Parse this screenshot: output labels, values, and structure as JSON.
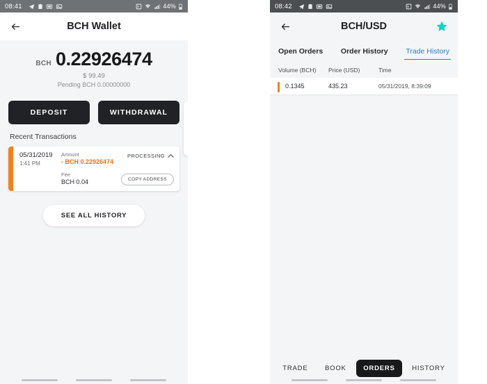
{
  "left_phone": {
    "status_bar": {
      "time": "08:41",
      "battery": "44%",
      "icons": [
        "telegram-icon",
        "clipboard-icon",
        "screenshot-icon",
        "gallery-icon",
        "vpn-icon",
        "wifi-icon",
        "signal-icon",
        "battery-icon"
      ]
    },
    "app_bar": {
      "back_label": "←",
      "title": "BCH Wallet"
    },
    "balance": {
      "unit": "BCH",
      "amount": "0.22926474",
      "fiat": "$ 99.49",
      "pending": "Pending BCH 0.00000000"
    },
    "actions": {
      "deposit": "DEPOSIT",
      "withdrawal": "WITHDRAWAL"
    },
    "recent_transactions_label": "Recent Transactions",
    "transaction": {
      "date": "05/31/2019",
      "time": "1:41 PM",
      "amount_label": "Amount",
      "amount_value": "- BCH 0.22926474",
      "fee_label": "Fee",
      "fee_value": "BCH 0.04",
      "status": "PROCESSING",
      "copy_button": "COPY ADDRESS",
      "accent_color": "#f2811d"
    },
    "see_all_history": "SEE ALL HISTORY"
  },
  "right_phone": {
    "status_bar": {
      "time": "08:42",
      "battery": "44%"
    },
    "app_bar": {
      "back_label": "←",
      "title": "BCH/USD",
      "star_color": "#10d5c3"
    },
    "tabs": [
      {
        "label": "Open Orders",
        "active": false
      },
      {
        "label": "Order History",
        "active": false
      },
      {
        "label": "Trade History",
        "active": true
      }
    ],
    "table": {
      "headers": {
        "volume": "Volume (BCH)",
        "price": "Price (USD)",
        "time": "Time"
      },
      "rows": [
        {
          "volume": "0.1345",
          "price": "435.23",
          "time": "05/31/2019, 8:39:09"
        }
      ],
      "accent_color": "#f2811d"
    },
    "bottom_nav": [
      {
        "label": "TRADE",
        "active": false
      },
      {
        "label": "BOOK",
        "active": false
      },
      {
        "label": "ORDERS",
        "active": true
      },
      {
        "label": "HISTORY",
        "active": false
      }
    ]
  },
  "theme": {
    "background": "#f4f5f7",
    "dark": "#17191b",
    "accent_orange": "#f2811d",
    "accent_teal": "#10d5c3",
    "link_blue": "#2a7fc1",
    "statusbar_gray": "#6f7275"
  }
}
